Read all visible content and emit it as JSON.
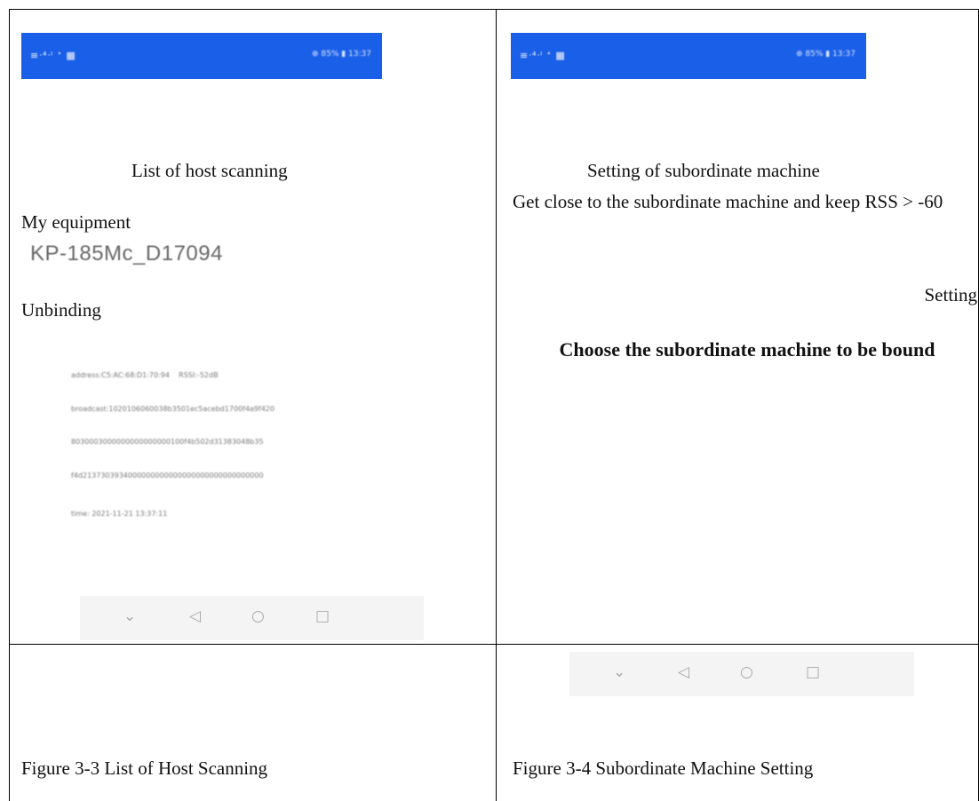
{
  "left_panel": {
    "title": "List of host scanning",
    "my_equipment_label": "My equipment",
    "device_name": "KP-185Mc_D17094",
    "unbinding_label": "Unbinding",
    "advertisement": {
      "line1": "address:C5:AC:68:D1:70:94    RSSI:-52dB",
      "line2": "broadcast:1020106060038b3501ec5acebd1700f4a9f420",
      "line3": "8030003000000000000000100f4b502d31383048b35",
      "line4": "f4d2137303934000000000000000000000000000000",
      "time": "time: 2021-11-21 13:37:11"
    }
  },
  "right_panel": {
    "title": "Setting of subordinate machine",
    "instruction": "Get close to the subordinate machine and keep RSS > -60",
    "setting_label": "Setting",
    "choose_heading": "Choose the subordinate machine to be bound"
  },
  "status_bar": {
    "left_text": "≡ᐧ⁴ᐧˡ ᐩ ▦",
    "right_text": "⊕ 85% ▮ 13:37",
    "color": "#1a5fe8"
  },
  "nav_bar": {
    "icons": [
      "chevron-down-icon",
      "back-triangle-icon",
      "home-circle-icon",
      "recents-square-icon"
    ],
    "glyphs": [
      "⌄",
      "◁",
      "○",
      "□"
    ]
  },
  "captions": {
    "left": "Figure 3-3 List of Host Scanning",
    "right": "Figure 3-4 Subordinate Machine Setting"
  }
}
